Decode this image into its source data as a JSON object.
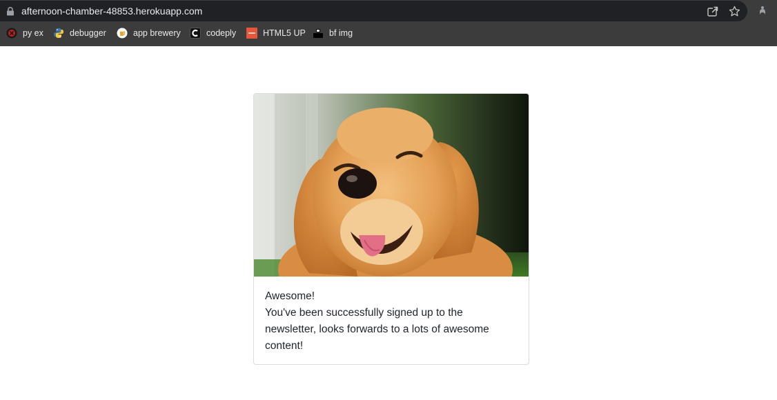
{
  "browser": {
    "url": "afternoon-chamber-48853.herokuapp.com",
    "bookmarks": [
      {
        "label": "py ex",
        "icon": "pyex-favicon"
      },
      {
        "label": "debugger",
        "icon": "python-favicon"
      },
      {
        "label": "app brewery",
        "icon": "appbrewery-favicon"
      },
      {
        "label": "codeply",
        "icon": "codeply-favicon"
      },
      {
        "label": "HTML5 UP",
        "icon": "html5up-favicon"
      },
      {
        "label": "bf img",
        "icon": "bfimg-favicon"
      }
    ]
  },
  "card": {
    "image_alt": "Smiling golden retriever",
    "title": "Awesome!",
    "message": "You've been successfully signed up to the newsletter, looks forwards to a lots of awesome content!"
  }
}
